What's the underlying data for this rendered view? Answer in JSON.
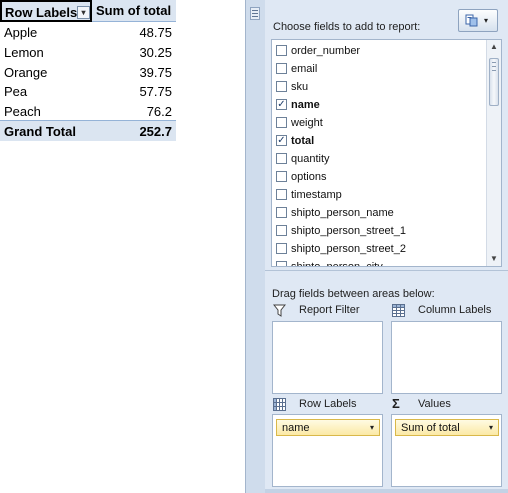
{
  "pivot": {
    "header": {
      "row_labels": "Row Labels",
      "filter_glyph": "▾",
      "sum_label": "Sum of total"
    },
    "rows": [
      {
        "label": "Apple",
        "value": "48.75"
      },
      {
        "label": "Lemon",
        "value": "30.25"
      },
      {
        "label": "Orange",
        "value": "39.75"
      },
      {
        "label": "Pea",
        "value": "57.75"
      },
      {
        "label": "Peach",
        "value": "76.2"
      }
    ],
    "total": {
      "label": "Grand Total",
      "value": "252.7"
    }
  },
  "field_list": {
    "choose_label": "Choose fields to add to report:",
    "layout_button": {
      "icon": "field-list-layout-icon",
      "caret": "▾"
    },
    "fields": [
      {
        "name": "order_number",
        "checked": false
      },
      {
        "name": "email",
        "checked": false
      },
      {
        "name": "sku",
        "checked": false
      },
      {
        "name": "name",
        "checked": true
      },
      {
        "name": "weight",
        "checked": false
      },
      {
        "name": "total",
        "checked": true
      },
      {
        "name": "quantity",
        "checked": false
      },
      {
        "name": "options",
        "checked": false
      },
      {
        "name": "timestamp",
        "checked": false
      },
      {
        "name": "shipto_person_name",
        "checked": false
      },
      {
        "name": "shipto_person_street_1",
        "checked": false
      },
      {
        "name": "shipto_person_street_2",
        "checked": false
      },
      {
        "name": "shipto_person_city",
        "checked": false
      }
    ],
    "scroll": {
      "up": "▲",
      "down": "▼"
    },
    "drag_label": "Drag fields between areas below:",
    "areas": {
      "report_filter": {
        "title": "Report Filter",
        "icon": "filter-funnel-icon"
      },
      "column_labels": {
        "title": "Column Labels",
        "icon": "column-grid-icon"
      },
      "row_labels": {
        "title": "Row Labels",
        "icon": "row-grid-icon",
        "chip": "name",
        "caret": "▾"
      },
      "values": {
        "title": "Values",
        "icon": "sigma-icon",
        "symbol": "Σ",
        "chip": "Sum of total",
        "caret": "▾"
      }
    },
    "colors": {
      "pane_bg": "#dfe8f4",
      "header_bg": "#dbe5f1",
      "chip_border": "#d9b84a"
    }
  }
}
